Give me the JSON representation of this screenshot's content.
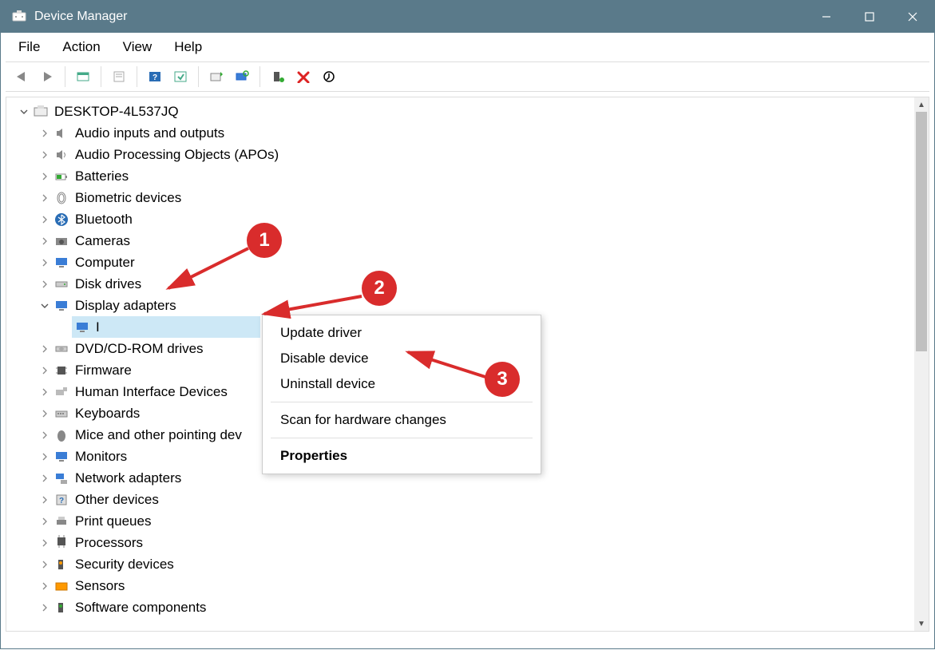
{
  "title": "Device Manager",
  "menu": {
    "file": "File",
    "action": "Action",
    "view": "View",
    "help": "Help"
  },
  "root": "DESKTOP-4L537JQ",
  "cats": {
    "audio_io": "Audio inputs and outputs",
    "apo": "Audio Processing Objects (APOs)",
    "batteries": "Batteries",
    "biometric": "Biometric devices",
    "bluetooth": "Bluetooth",
    "cameras": "Cameras",
    "computer": "Computer",
    "disk": "Disk drives",
    "display": "Display adapters",
    "display_child": "I",
    "dvd": "DVD/CD-ROM drives",
    "firmware": "Firmware",
    "hid": "Human Interface Devices",
    "keyboards": "Keyboards",
    "mice": "Mice and other pointing dev",
    "monitors": "Monitors",
    "network": "Network adapters",
    "other": "Other devices",
    "print": "Print queues",
    "processors": "Processors",
    "security": "Security devices",
    "sensors": "Sensors",
    "software": "Software components"
  },
  "ctx": {
    "update": "Update driver",
    "disable": "Disable device",
    "uninstall": "Uninstall device",
    "scan": "Scan for hardware changes",
    "properties": "Properties"
  },
  "annotations": {
    "s1": "1",
    "s2": "2",
    "s3": "3"
  }
}
